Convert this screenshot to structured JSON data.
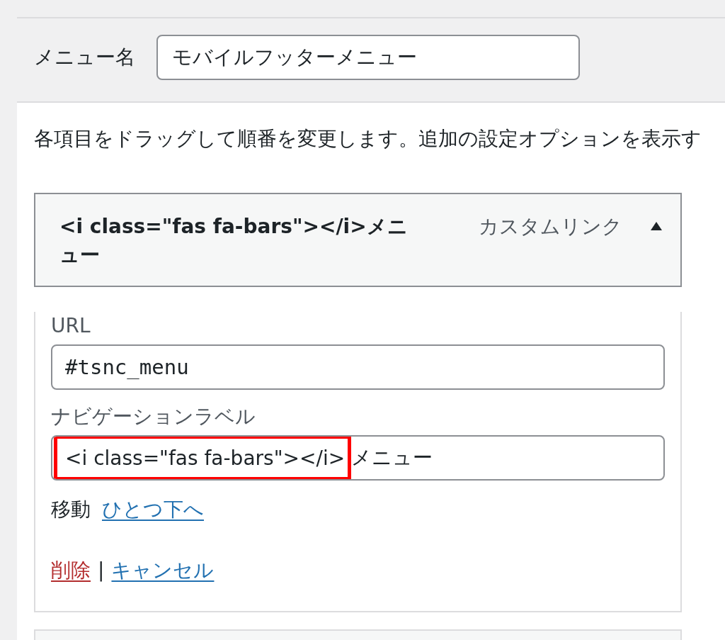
{
  "menu_name": {
    "label": "メニュー名",
    "value": "モバイルフッターメニュー"
  },
  "instructions": "各項目をドラッグして順番を変更します。追加の設定オプションを表示す",
  "menu_items": [
    {
      "title": "<i class=\"fas fa-bars\"></i>メニュー",
      "type": "カスタムリンク",
      "expanded": true,
      "fields": [
        {
          "kind": "url",
          "label": "URL",
          "value": "#tsnc_menu"
        },
        {
          "kind": "segmented",
          "label": "ナビゲーションラベル",
          "segments": [
            {
              "text": "<i class=\"fas fa-bars\"></i>",
              "highlighted": true
            },
            {
              "text": "メニュー",
              "highlighted": false
            }
          ]
        }
      ],
      "move": {
        "label": "移動",
        "links": [
          "ひとつ下へ"
        ]
      },
      "actions": [
        {
          "kind": "delete",
          "label": "削除"
        },
        {
          "kind": "separator",
          "label": "|"
        },
        {
          "kind": "cancel",
          "label": "キャンセル"
        }
      ]
    }
  ]
}
